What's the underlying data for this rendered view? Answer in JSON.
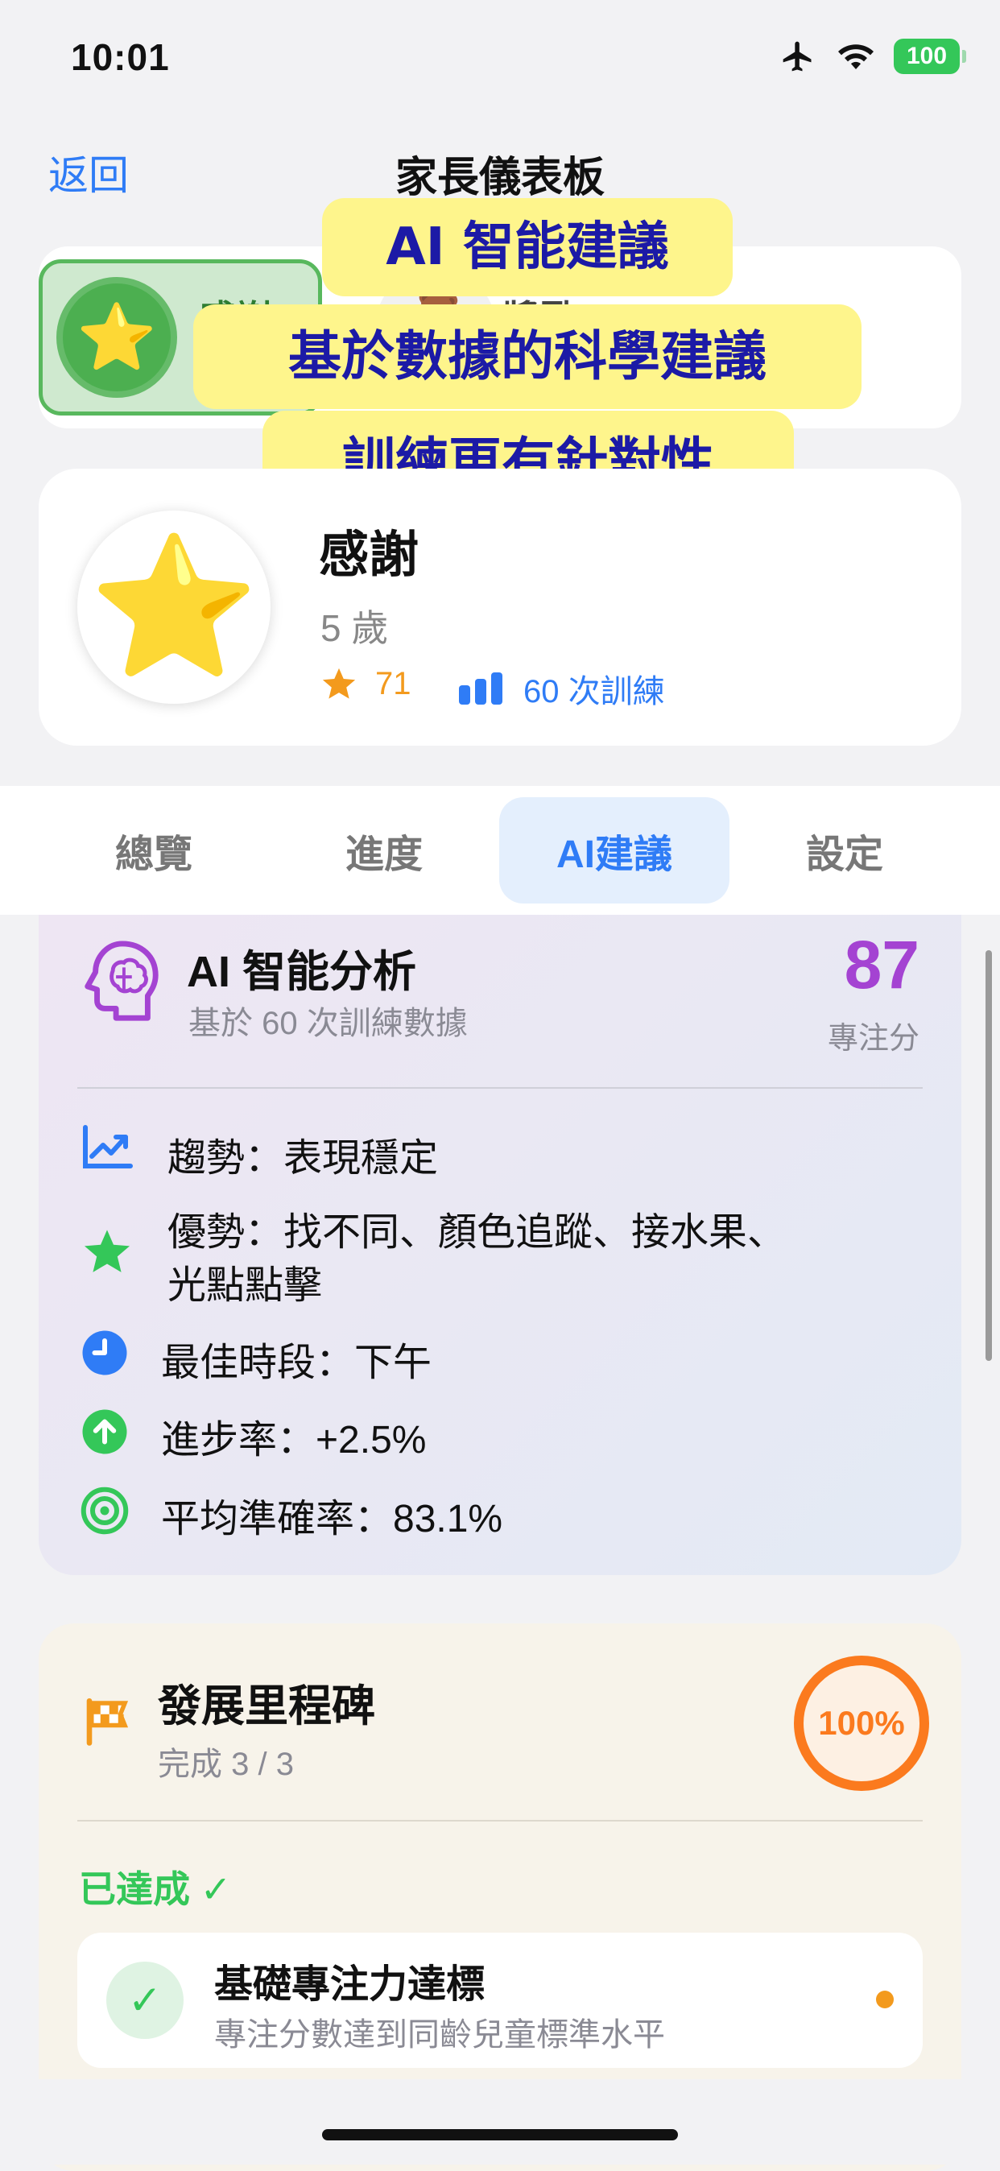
{
  "status_bar": {
    "time": "10:01",
    "battery": "100"
  },
  "nav": {
    "back_label": "返回",
    "title": "家長儀表板"
  },
  "children": [
    {
      "name": "感謝",
      "avatar": "⭐",
      "selected": true
    },
    {
      "name": "獎勵",
      "avatar": "🧸",
      "selected": false
    }
  ],
  "overlay_banner": {
    "line1": "AI 智能建議",
    "line2": "基於數據的科學建議",
    "line3": "訓練更有針對性"
  },
  "profile": {
    "name": "感謝",
    "age": "5 歲",
    "stars": "71",
    "sessions": "60 次訓練",
    "avatar": "⭐"
  },
  "tabs": [
    {
      "label": "總覽",
      "active": false
    },
    {
      "label": "進度",
      "active": false
    },
    {
      "label": "AI建議",
      "active": true
    },
    {
      "label": "設定",
      "active": false
    }
  ],
  "ai_analysis": {
    "title": "AI 智能分析",
    "subtitle": "基於 60 次訓練數據",
    "score": "87",
    "score_label": "專注分",
    "rows": [
      {
        "icon": "trend-chart-icon",
        "text": "趨勢：表現穩定"
      },
      {
        "icon": "star-icon",
        "text_line1": "優勢：找不同、顏色追蹤、接水果、",
        "text_line2": "光點點擊"
      },
      {
        "icon": "clock-icon",
        "text": "最佳時段：下午"
      },
      {
        "icon": "arrow-up-circle-icon",
        "text": "進步率：+2.5%"
      },
      {
        "icon": "target-icon",
        "text": "平均準確率：83.1%"
      }
    ],
    "colors": {
      "accent": "#a443d2"
    }
  },
  "milestones": {
    "title": "發展里程碑",
    "subtitle": "完成 3 / 3",
    "percent": "100%",
    "achieved_label": "已達成 ✓",
    "items": [
      {
        "title": "基礎專注力達標",
        "desc": "專注分數達到同齡兒童標準水平"
      }
    ]
  }
}
